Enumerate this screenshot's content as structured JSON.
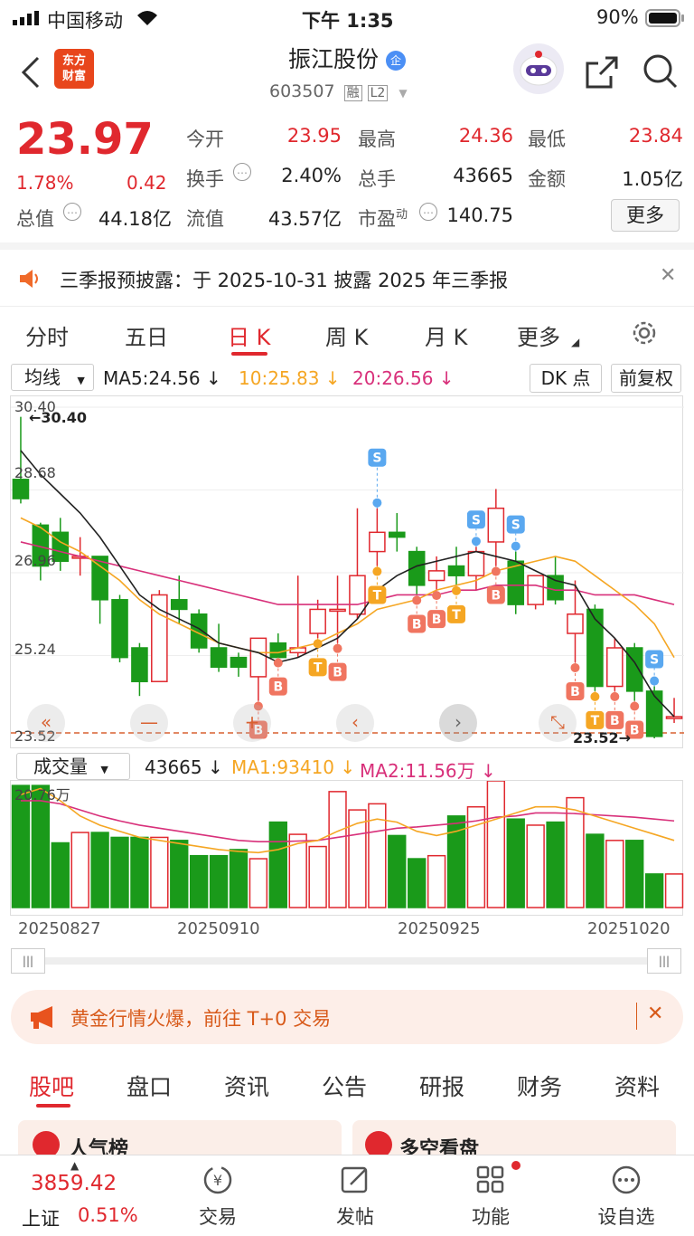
{
  "status": {
    "carrier": "中国移动",
    "time": "下午 1:35",
    "battery": "90%"
  },
  "header": {
    "logo_line1": "东方",
    "logo_line2": "财富",
    "title": "振江股份",
    "title_badge": "企",
    "code": "603507",
    "tag1": "融",
    "tag2": "L2"
  },
  "quote": {
    "price": "23.97",
    "pct": "1.78%",
    "change": "0.42",
    "open_label": "今开",
    "open": "23.95",
    "high_label": "最高",
    "high": "24.36",
    "low_label": "最低",
    "low": "23.84",
    "turnover_label": "换手",
    "turnover": "2.40%",
    "vol_label": "总手",
    "vol": "43665",
    "amount_label": "金额",
    "amount": "1.05亿",
    "mktcap_label": "总值",
    "mktcap": "44.18亿",
    "float_label": "流值",
    "float": "43.57亿",
    "pe_label": "市盈",
    "pe_sup": "动",
    "pe": "140.75",
    "more": "更多"
  },
  "notice": {
    "text": "三季报预披露：于 2025-10-31 披露 2025 年三季报"
  },
  "tabs": [
    "分时",
    "五日",
    "日 K",
    "周 K",
    "月 K",
    "更多"
  ],
  "chart_controls": {
    "indicator": "均线",
    "ma5": "MA5:24.56",
    "ma10": "10:25.83",
    "ma20": "20:26.56",
    "dk": "DK 点",
    "fuquan": "前复权"
  },
  "price_axis": [
    "30.40",
    "28.68",
    "26.96",
    "25.24",
    "23.52"
  ],
  "annotations": {
    "high": "30.40",
    "low": "23.52"
  },
  "volume_header": {
    "label": "成交量",
    "vol": "43665",
    "ma1": "MA1:93410",
    "ma2": "MA2:11.56万",
    "axis_max": "20.76万"
  },
  "dates": [
    "20250827",
    "20250910",
    "20250925",
    "20251020"
  ],
  "colors": {
    "up": "#e0282e",
    "down": "#1a9a1a",
    "ma5": "#222222",
    "ma10": "#f5a623",
    "ma20": "#d8307a"
  },
  "chart_data": {
    "type": "candlestick",
    "ylim": [
      23.52,
      30.4
    ],
    "candles": [
      {
        "o": 28.9,
        "c": 28.5,
        "h": 30.2,
        "l": 28.4
      },
      {
        "o": 27.95,
        "c": 27.1,
        "h": 28.0,
        "l": 26.8
      },
      {
        "o": 27.8,
        "c": 27.2,
        "h": 28.1,
        "l": 27.0
      },
      {
        "o": 27.3,
        "c": 27.3,
        "h": 27.7,
        "l": 26.9
      },
      {
        "o": 27.3,
        "c": 26.4,
        "h": 27.3,
        "l": 25.9
      },
      {
        "o": 26.4,
        "c": 25.2,
        "h": 26.5,
        "l": 25.1
      },
      {
        "o": 25.4,
        "c": 24.7,
        "h": 25.5,
        "l": 24.4
      },
      {
        "o": 24.7,
        "c": 26.5,
        "h": 26.6,
        "l": 24.7
      },
      {
        "o": 26.4,
        "c": 26.2,
        "h": 26.9,
        "l": 25.9
      },
      {
        "o": 26.1,
        "c": 25.4,
        "h": 26.2,
        "l": 25.3
      },
      {
        "o": 25.4,
        "c": 25.0,
        "h": 25.9,
        "l": 24.9
      },
      {
        "o": 25.2,
        "c": 25.0,
        "h": 25.3,
        "l": 24.8
      },
      {
        "o": 24.8,
        "c": 25.6,
        "h": 25.6,
        "l": 24.3
      },
      {
        "o": 25.5,
        "c": 25.2,
        "h": 25.7,
        "l": 25.2
      },
      {
        "o": 25.3,
        "c": 25.4,
        "h": 26.9,
        "l": 25.2
      },
      {
        "o": 25.7,
        "c": 26.2,
        "h": 26.4,
        "l": 25.6
      },
      {
        "o": 26.2,
        "c": 26.2,
        "h": 26.9,
        "l": 25.5
      },
      {
        "o": 26.1,
        "c": 26.9,
        "h": 28.3,
        "l": 26.0
      },
      {
        "o": 27.4,
        "c": 27.8,
        "h": 28.3,
        "l": 27.1
      },
      {
        "o": 27.8,
        "c": 27.7,
        "h": 28.2,
        "l": 27.4
      },
      {
        "o": 27.4,
        "c": 26.7,
        "h": 27.5,
        "l": 26.5
      },
      {
        "o": 26.8,
        "c": 27.0,
        "h": 27.3,
        "l": 26.6
      },
      {
        "o": 27.1,
        "c": 26.9,
        "h": 27.5,
        "l": 26.7
      },
      {
        "o": 26.9,
        "c": 27.4,
        "h": 27.5,
        "l": 26.6
      },
      {
        "o": 27.6,
        "c": 28.3,
        "h": 28.7,
        "l": 27.1
      },
      {
        "o": 27.2,
        "c": 26.3,
        "h": 27.4,
        "l": 26.1
      },
      {
        "o": 26.3,
        "c": 26.9,
        "h": 26.9,
        "l": 26.2
      },
      {
        "o": 26.9,
        "c": 26.4,
        "h": 27.3,
        "l": 26.3
      },
      {
        "o": 25.7,
        "c": 26.1,
        "h": 26.8,
        "l": 25.1
      },
      {
        "o": 26.2,
        "c": 24.6,
        "h": 26.3,
        "l": 24.5
      },
      {
        "o": 24.6,
        "c": 25.4,
        "h": 25.6,
        "l": 24.5
      },
      {
        "o": 25.4,
        "c": 24.5,
        "h": 25.5,
        "l": 24.3
      },
      {
        "o": 24.5,
        "c": 23.56,
        "h": 24.6,
        "l": 23.52
      },
      {
        "o": 23.95,
        "c": 23.97,
        "h": 24.36,
        "l": 23.84
      }
    ],
    "ma5": [
      29.5,
      29.0,
      28.6,
      28.2,
      27.7,
      27.1,
      26.5,
      26.2,
      26.0,
      25.8,
      25.5,
      25.4,
      25.3,
      25.1,
      25.2,
      25.4,
      25.6,
      26.0,
      26.6,
      26.9,
      27.1,
      27.2,
      27.3,
      27.4,
      27.3,
      27.2,
      27.0,
      26.8,
      26.7,
      26.0,
      25.6,
      25.1,
      24.4,
      23.97
    ],
    "ma10": [
      28.1,
      27.9,
      27.6,
      27.4,
      27.1,
      26.8,
      26.4,
      26.1,
      25.9,
      25.7,
      25.5,
      25.4,
      25.3,
      25.3,
      25.4,
      25.5,
      25.7,
      25.9,
      26.2,
      26.3,
      26.4,
      26.6,
      26.7,
      26.8,
      27.0,
      27.1,
      27.2,
      27.3,
      27.2,
      26.9,
      26.6,
      26.3,
      25.9,
      25.2
    ],
    "ma20": [
      27.6,
      27.5,
      27.4,
      27.3,
      27.2,
      27.1,
      27.0,
      26.9,
      26.8,
      26.7,
      26.6,
      26.5,
      26.4,
      26.3,
      26.3,
      26.3,
      26.3,
      26.3,
      26.4,
      26.5,
      26.5,
      26.5,
      26.6,
      26.6,
      26.7,
      26.7,
      26.7,
      26.6,
      26.6,
      26.5,
      26.5,
      26.5,
      26.4,
      26.3
    ],
    "signals": [
      {
        "i": 12,
        "t": "B"
      },
      {
        "i": 13,
        "t": "B"
      },
      {
        "i": 15,
        "t": "T"
      },
      {
        "i": 16,
        "t": "B"
      },
      {
        "i": 18,
        "t": "T"
      },
      {
        "i": 18,
        "t": "S"
      },
      {
        "i": 20,
        "t": "B"
      },
      {
        "i": 21,
        "t": "B"
      },
      {
        "i": 22,
        "t": "T"
      },
      {
        "i": 23,
        "t": "S"
      },
      {
        "i": 24,
        "t": "B"
      },
      {
        "i": 25,
        "t": "S"
      },
      {
        "i": 28,
        "t": "B"
      },
      {
        "i": 29,
        "t": "T"
      },
      {
        "i": 30,
        "t": "B"
      },
      {
        "i": 31,
        "t": "B"
      },
      {
        "i": 32,
        "t": "S"
      }
    ],
    "volume": [
      20.0,
      20.0,
      10.6,
      12.3,
      12.3,
      11.5,
      11.5,
      11.5,
      11.0,
      8.5,
      8.5,
      9.5,
      8.0,
      14.0,
      12.0,
      10.0,
      19.0,
      16.0,
      17.0,
      11.8,
      8.0,
      8.5,
      15.0,
      16.5,
      20.76,
      14.5,
      13.5,
      14.0,
      18.0,
      12.0,
      11.0,
      11.0,
      5.5,
      5.5
    ],
    "vol_ma1": [
      18.5,
      19.5,
      17.5,
      15.0,
      13.5,
      12.5,
      11.5,
      11.0,
      10.5,
      10.0,
      9.5,
      9.2,
      9.0,
      9.5,
      10.5,
      11.0,
      12.5,
      13.8,
      14.5,
      14.0,
      12.5,
      11.8,
      12.5,
      13.5,
      14.5,
      15.5,
      16.5,
      16.5,
      16.0,
      15.0,
      14.0,
      13.0,
      12.0,
      11.0
    ],
    "vol_ma2": [
      17.5,
      17.5,
      17.0,
      16.0,
      15.0,
      14.2,
      13.5,
      13.0,
      12.5,
      12.0,
      11.5,
      11.0,
      10.8,
      10.8,
      10.9,
      11.0,
      11.5,
      12.0,
      12.5,
      13.0,
      13.2,
      13.5,
      13.8,
      14.2,
      14.8,
      15.0,
      15.5,
      15.5,
      15.4,
      15.2,
      15.0,
      14.8,
      14.5,
      14.2
    ]
  },
  "promo": {
    "text": "黄金行情火爆，前往 T+0 交易"
  },
  "bottom_tabs": [
    "股吧",
    "盘口",
    "资讯",
    "公告",
    "研报",
    "财务",
    "资料"
  ],
  "partial_cards": [
    "人气榜",
    "多空看盘"
  ],
  "index": {
    "value": "3859.42",
    "name": "上证",
    "pct": "0.51%"
  },
  "bottom_nav": [
    "交易",
    "发帖",
    "功能",
    "设自选"
  ]
}
